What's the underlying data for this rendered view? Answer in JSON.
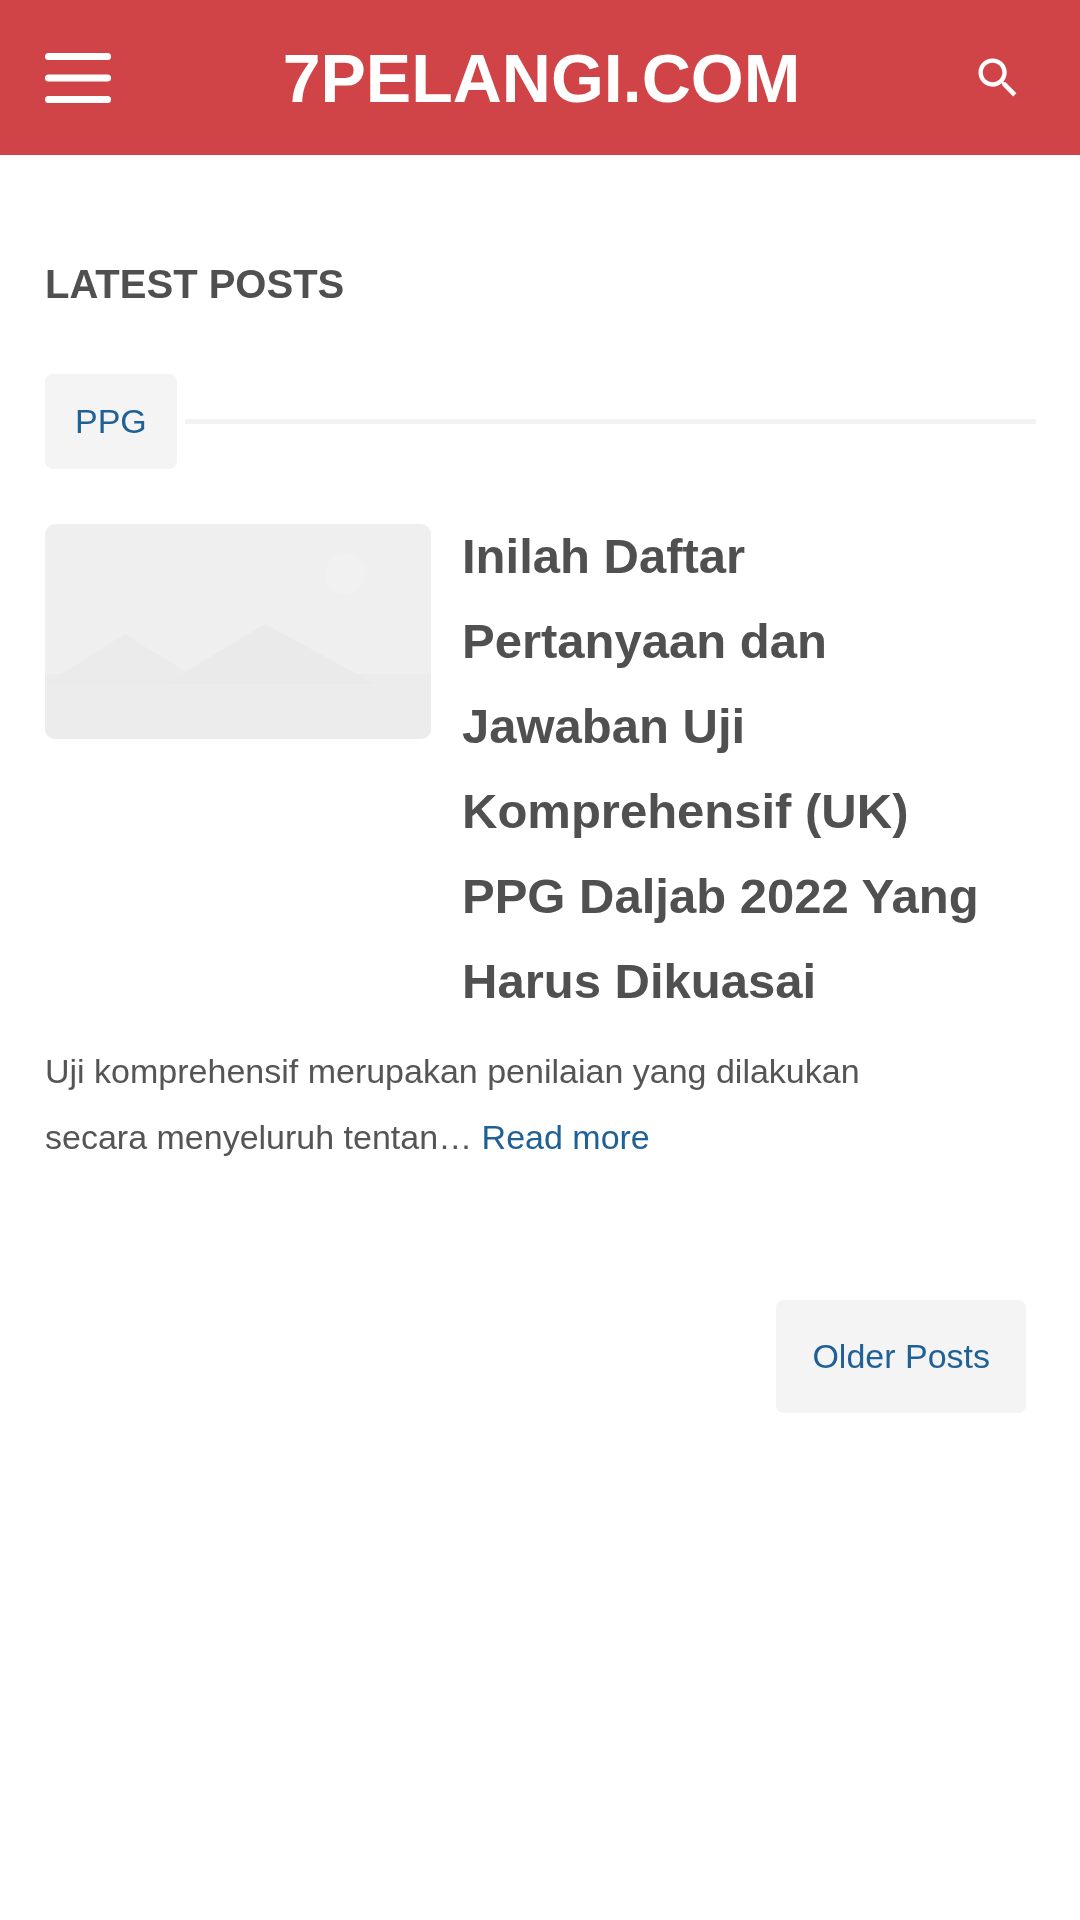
{
  "header": {
    "site_title": "7PELANGI.COM"
  },
  "section_title": "LATEST POSTS",
  "posts": [
    {
      "label": "PPG",
      "title": "Inilah Daftar Pertanyaan dan Jawaban Uji Komprehensif (UK) PPG Daljab 2022 Yang Harus Dikuasai",
      "excerpt": "Uji komprehensif merupakan penilaian yang dilakukan secara menyeluruh tentan…",
      "read_more": "Read more"
    }
  ],
  "pagination": {
    "older": "Older Posts"
  }
}
